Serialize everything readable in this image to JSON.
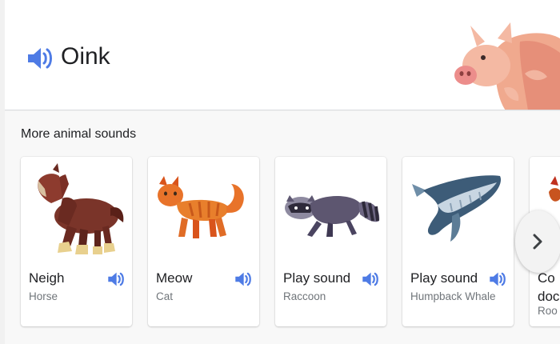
{
  "hero": {
    "title": "Oink",
    "speaker_icon": "volume-icon",
    "image": "pig-illustration"
  },
  "more_sounds": {
    "heading": "More animal sounds",
    "cards": [
      {
        "label": "Neigh",
        "subtitle": "Horse",
        "image": "horse-illustration"
      },
      {
        "label": "Meow",
        "subtitle": "Cat",
        "image": "cat-illustration"
      },
      {
        "label": "Play sound",
        "subtitle": "Raccoon",
        "image": "raccoon-illustration"
      },
      {
        "label": "Play sound",
        "subtitle": "Humpback Whale",
        "image": "humpback-whale-illustration"
      },
      {
        "label": "Co",
        "label_line2": "doc",
        "subtitle": "Roo",
        "image": "rooster-illustration"
      }
    ],
    "next_icon": "chevron-right-icon"
  },
  "colors": {
    "speaker_blue": "#4e7be5",
    "text_primary": "#202124",
    "text_secondary": "#70757a"
  }
}
